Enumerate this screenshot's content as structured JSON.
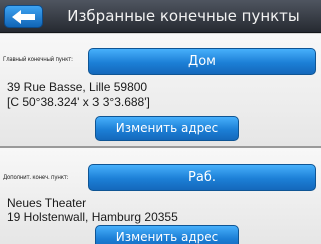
{
  "header": {
    "back_icon": "arrow-left-icon",
    "title": "Избранные конечные пункты"
  },
  "home": {
    "label": "Главный конечный пункт:",
    "name": "Дом",
    "address_line1": "39 Rue Basse, Lille 59800",
    "address_line2": "[С 50°38.324' х З 3°3.688']",
    "change_label": "Изменить адрес"
  },
  "work": {
    "label": "Дополнит. конеч. пункт:",
    "name": "Раб.",
    "address_line1": "Neues Theater",
    "address_line2": "19 Holstenwall, Hamburg 20355",
    "change_label": "Изменить адрес"
  },
  "colors": {
    "accent": "#1c7fd6",
    "header_bg": "#2f343c"
  }
}
